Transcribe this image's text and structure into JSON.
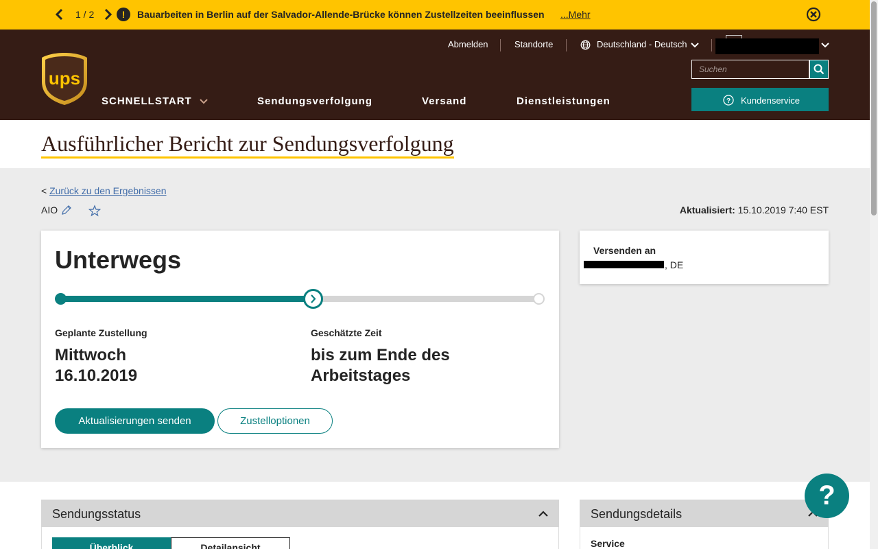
{
  "alert": {
    "pager": "1 / 2",
    "message": "Bauarbeiten in Berlin auf der Salvador-Allende-Brücke können Zustellzeiten beeinflussen",
    "more": "...Mehr"
  },
  "header": {
    "brand": "ups",
    "util": {
      "logout": "Abmelden",
      "locations": "Standorte",
      "language": "Deutschland - Deutsch"
    },
    "search_placeholder": "Suchen",
    "nav": {
      "quickstart": "SCHNELLSTART",
      "tracking": "Sendungsverfolgung",
      "shipping": "Versand",
      "services": "Dienstleistungen"
    },
    "customer_service": "Kundenservice"
  },
  "page": {
    "title": "Ausführlicher Bericht zur Sendungsverfolgung",
    "back_prefix": "<",
    "back_link": "Zurück zu den Ergebnissen",
    "tracking_alias": "AIO",
    "updated_label": "Aktualisiert:",
    "updated_value": "15.10.2019 7:40 EST"
  },
  "status": {
    "headline": "Unterwegs",
    "progress": 0.53,
    "planned_label": "Geplante Zustellung",
    "planned_value": "Mittwoch 16.10.2019",
    "time_label": "Geschätzte Zeit",
    "time_value": "bis zum Ende des Arbeitstages",
    "btn_updates": "Aktualisierungen senden",
    "btn_options": "Zustelloptionen"
  },
  "ship_to": {
    "label": "Versenden an",
    "country": ", DE"
  },
  "panels": {
    "status_title": "Sendungsstatus",
    "tab_overview": "Überblick",
    "tab_details": "Detailansicht",
    "details_title": "Sendungsdetails",
    "service_label": "Service"
  },
  "help": "?",
  "colors": {
    "brown": "#351c15",
    "gold": "#ffc400",
    "teal": "#0a8080"
  }
}
